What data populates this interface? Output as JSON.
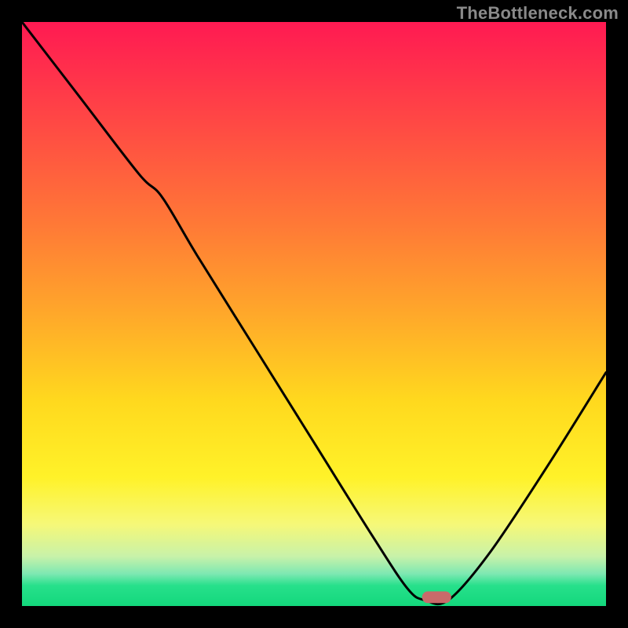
{
  "watermark": "TheBottleneck.com",
  "chart_data": {
    "type": "line",
    "title": "",
    "xlabel": "",
    "ylabel": "",
    "xlim": [
      0,
      100
    ],
    "ylim": [
      0,
      100
    ],
    "grid": false,
    "legend": false,
    "series": [
      {
        "name": "bottleneck-curve",
        "x": [
          0,
          10,
          20,
          24,
          30,
          40,
          50,
          60,
          66,
          69,
          73,
          80,
          90,
          100
        ],
        "y": [
          100,
          87,
          74,
          70,
          60,
          44,
          28,
          12,
          3,
          1,
          1,
          9,
          24,
          40
        ]
      }
    ],
    "marker": {
      "name": "target-point",
      "x": 71,
      "y": 1.5,
      "width": 5,
      "height": 2
    },
    "background_gradient": {
      "stops": [
        {
          "pos": 0,
          "color": "#ff1a52"
        },
        {
          "pos": 0.35,
          "color": "#ff7a36"
        },
        {
          "pos": 0.65,
          "color": "#ffd91e"
        },
        {
          "pos": 0.86,
          "color": "#f6f878"
        },
        {
          "pos": 0.965,
          "color": "#27e08b"
        },
        {
          "pos": 1.0,
          "color": "#13d87c"
        }
      ]
    }
  }
}
